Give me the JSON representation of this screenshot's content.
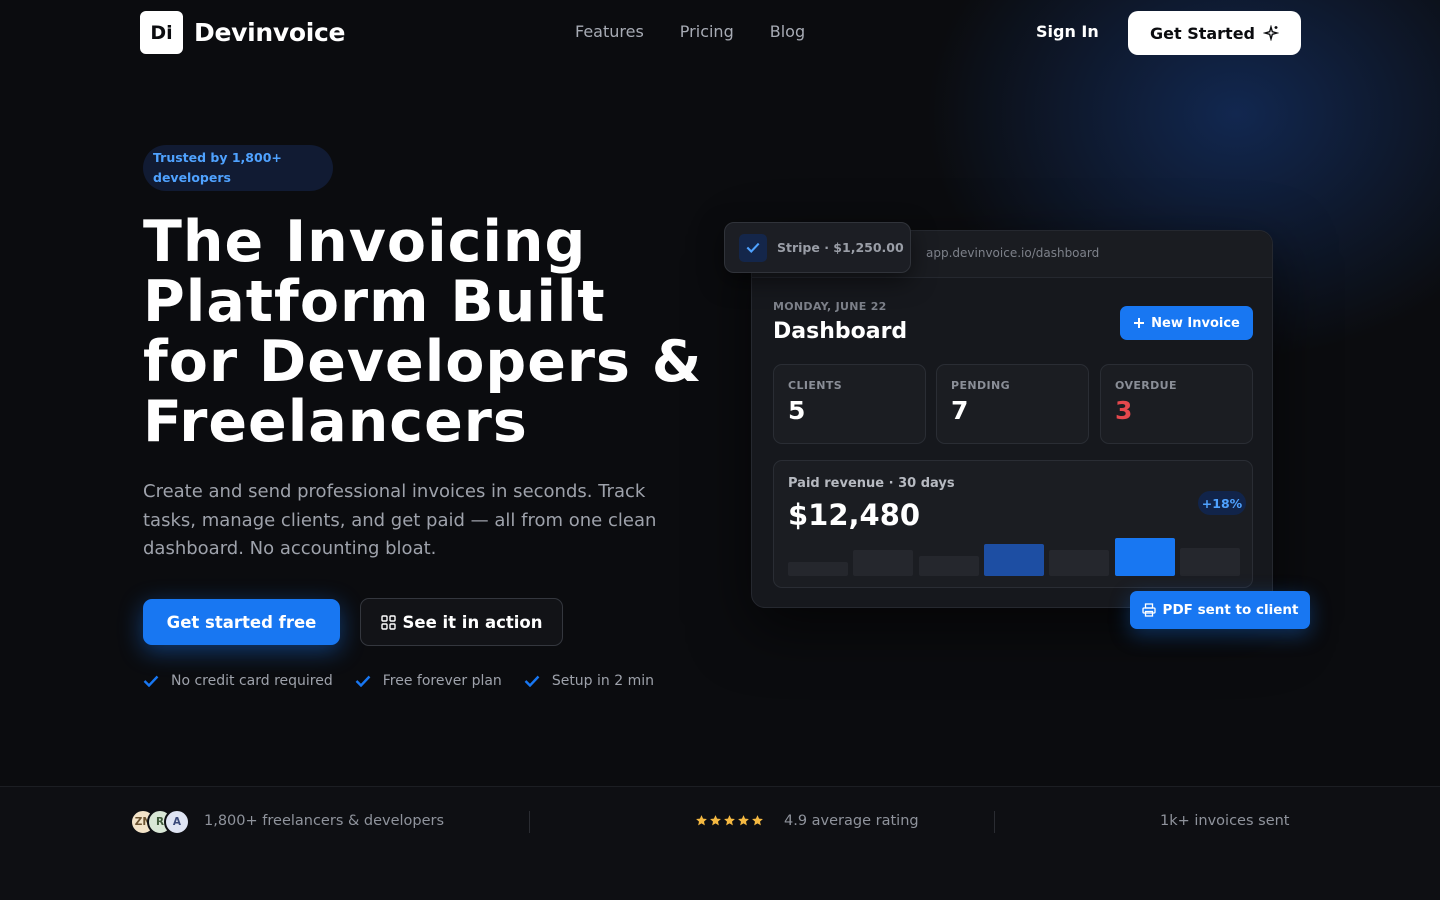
{
  "colors": {
    "accent": "#1877f2",
    "accent_text": "#4fa2ff",
    "danger": "#e5484d",
    "star": "#f5b942"
  },
  "nav": {
    "logo_mark": "Di",
    "brand": "Devinvoice",
    "links": [
      {
        "label": "Features"
      },
      {
        "label": "Pricing"
      },
      {
        "label": "Blog"
      }
    ],
    "sign_in": "Sign In",
    "get_started": "Get Started",
    "get_started_icon": "sparkle-icon"
  },
  "hero": {
    "badge": "Trusted by 1,800+ developers",
    "headline": "The Invoicing Platform Built for Developers & Freelancers",
    "subheadline": "Create and send professional invoices in seconds. Track tasks, manage clients, and get paid — all from one clean dashboard. No accounting bloat.",
    "primary_cta": "Get started free",
    "secondary_cta": "See it in action",
    "secondary_cta_icon": "grid-icon",
    "checks": [
      "No credit card required",
      "Free forever plan",
      "Setup in 2 min"
    ]
  },
  "dashboard": {
    "url": "app.devinvoice.io/dashboard",
    "stripe_toast": "Stripe · $1,250.00",
    "date": "MONDAY, JUNE 22",
    "title": "Dashboard",
    "new_invoice": "New Invoice",
    "stats": [
      {
        "label": "CLIENTS",
        "value": "5"
      },
      {
        "label": "PENDING",
        "value": "7"
      },
      {
        "label": "OVERDUE",
        "value": "3"
      }
    ],
    "revenue": {
      "label": "Paid revenue · 30 days",
      "value": "$12,480",
      "change": "+18%",
      "bars": [
        0.35,
        0.65,
        0.5,
        0.8,
        0.65,
        0.95,
        0.7
      ],
      "highlight": [
        3,
        5
      ]
    },
    "pdf_toast": "PDF sent to client",
    "pdf_icon": "printer-icon"
  },
  "proof": {
    "avatars": [
      "ZN",
      "R",
      "A"
    ],
    "users": "1,800+ freelancers & developers",
    "rating": "4.9 average rating",
    "stars": 5,
    "invoices": "1k+ invoices sent"
  }
}
